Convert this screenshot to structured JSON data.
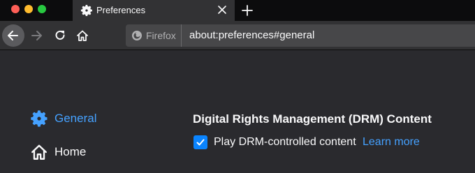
{
  "tab": {
    "title": "Preferences"
  },
  "urlbar": {
    "identity_label": "Firefox",
    "url": "about:preferences#general"
  },
  "sidebar": {
    "items": [
      {
        "label": "General",
        "icon": "gear-icon"
      },
      {
        "label": "Home",
        "icon": "home-icon"
      }
    ]
  },
  "drm": {
    "title": "Digital Rights Management (DRM) Content",
    "checkbox_label": "Play DRM-controlled content",
    "checked": true,
    "learn_more": "Learn more"
  },
  "colors": {
    "accent": "#0a84ff",
    "link": "#45a1ff",
    "background": "#2a2a2e"
  }
}
